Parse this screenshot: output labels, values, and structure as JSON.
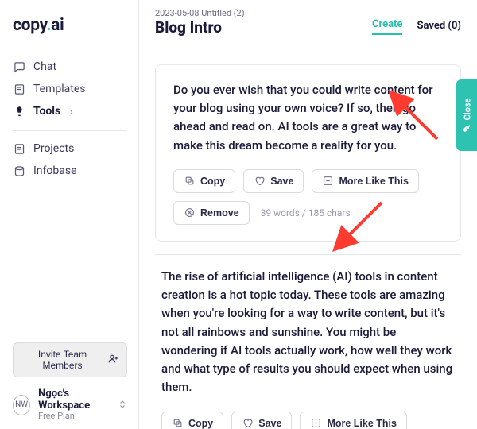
{
  "brand": {
    "name_part1": "copy",
    "name_part2": "ai"
  },
  "sidebar": {
    "items": [
      {
        "label": "Chat"
      },
      {
        "label": "Templates"
      },
      {
        "label": "Tools"
      },
      {
        "label": "Projects"
      },
      {
        "label": "Infobase"
      }
    ],
    "invite_label": "Invite Team Members",
    "workspace": {
      "initials": "NW",
      "name": "Ngọc's Workspace",
      "plan": "Free Plan"
    }
  },
  "header": {
    "breadcrumb": "2023-05-08 Untitled (2)",
    "title": "Blog Intro",
    "tabs": {
      "create": "Create",
      "saved": "Saved (0)"
    }
  },
  "close_tab": {
    "label": "Close"
  },
  "results": [
    {
      "text": "Do you ever wish that you could write content for your blog using your own voice? If so, then go ahead and read on. AI tools are a great way to make this dream become a reality for you.",
      "stat": "39 words / 185 chars"
    },
    {
      "text": "The rise of artificial intelligence (AI) tools in content creation is a hot topic today. These tools are amazing when you're looking for a way to write content, but it's not all rainbows and sunshine. You might be wondering if AI tools actually work, how well they work and what type of results you should expect when using them."
    }
  ],
  "buttons": {
    "copy": "Copy",
    "save": "Save",
    "more": "More Like This",
    "remove": "Remove"
  }
}
